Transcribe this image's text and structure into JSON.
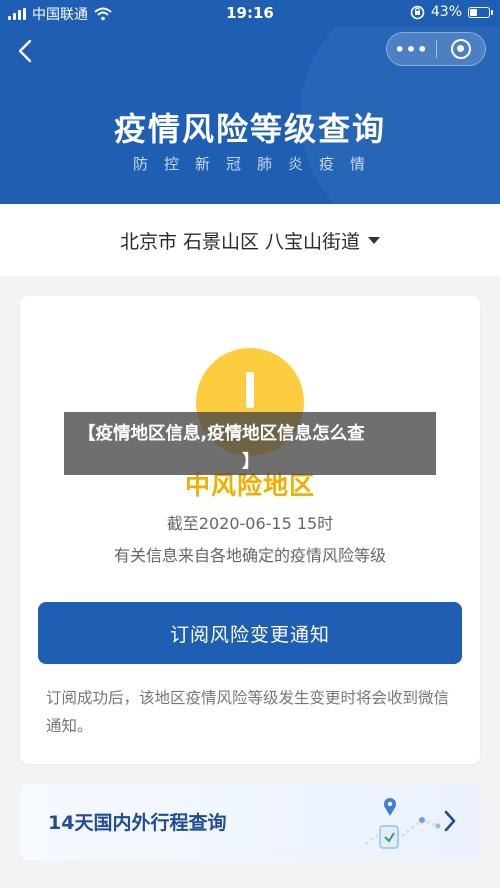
{
  "status_bar": {
    "carrier": "中国联通",
    "time": "19:16",
    "battery_percent": "43%",
    "battery_level": 0.43,
    "icons": [
      "signal-icon",
      "wifi-icon",
      "rotation-lock-icon",
      "battery-icon"
    ]
  },
  "header": {
    "title": "疫情风险等级查询",
    "subtitle": "防控新冠肺炎疫情",
    "background_color": "#1f5fb3",
    "icons": [
      "back-icon",
      "more-icon",
      "close-mini-program-icon"
    ]
  },
  "location": {
    "text": "北京市 石景山区 八宝山街道",
    "icon": "dropdown-caret-icon"
  },
  "risk_card": {
    "level": "中风险地区",
    "level_color": "#fbcd3f",
    "deadline": "截至2020-06-15 15时",
    "source": "有关信息来自各地确定的疫情风险等级",
    "subscribe_button": "订阅风险变更通知",
    "note": "订阅成功后，该地区疫情风险等级发生变更时将会收到微信通知。"
  },
  "travel_card": {
    "label": "14天国内外行程查询",
    "icons": [
      "route-map-icon",
      "chevron-right-icon"
    ]
  },
  "overlay": {
    "line1": "【疫情地区信息,疫情地区信息怎么查",
    "line2": "】"
  }
}
